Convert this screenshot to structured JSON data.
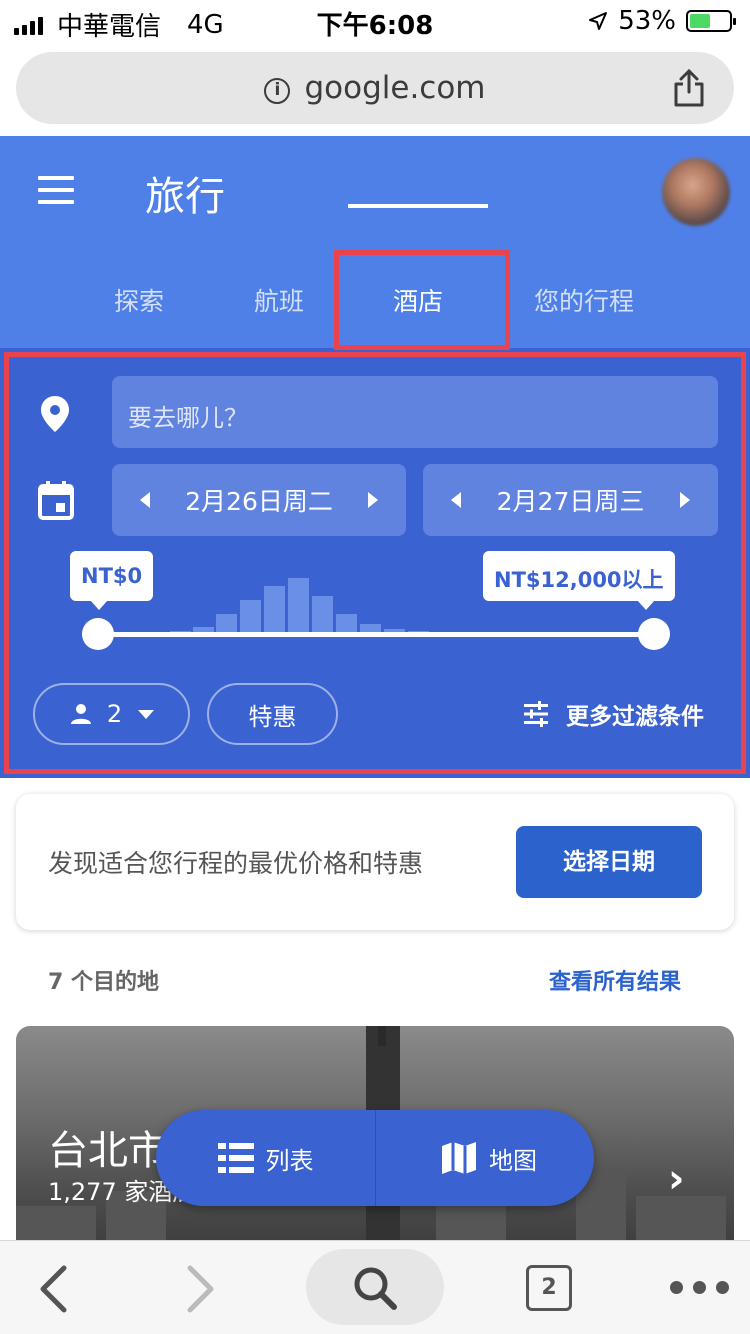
{
  "status_bar": {
    "carrier": "中華電信",
    "network": "4G",
    "time": "下午6:08",
    "battery": "53%",
    "battery_fraction": 0.53
  },
  "browser": {
    "url": "google.com"
  },
  "app": {
    "title": "旅行"
  },
  "tabs": [
    {
      "label": "探索",
      "active": false
    },
    {
      "label": "航班",
      "active": false
    },
    {
      "label": "酒店",
      "active": true
    },
    {
      "label": "您的行程",
      "active": false
    }
  ],
  "search": {
    "destination_placeholder": "要去哪儿？",
    "check_in": "2月26日周二",
    "check_out": "2月27日周三",
    "price_min": "NT$0",
    "price_max": "NT$12,000以上",
    "guests": "2",
    "deals_label": "特惠",
    "more_filters": "更多过滤条件"
  },
  "promo": {
    "text": "发现适合您行程的最优价格和特惠",
    "button": "选择日期"
  },
  "results": {
    "count_label": "7 个目的地",
    "view_all": "查看所有结果"
  },
  "destination_card": {
    "city": "台北市",
    "hotels": "1,277 家酒店"
  },
  "view_toggle": {
    "list": "列表",
    "map": "地图"
  },
  "bottom_bar": {
    "tab_count": "2"
  },
  "colors": {
    "header": "#4f80e8",
    "panel": "#3a62d0",
    "accent": "#2b62cc",
    "highlight": "#e8434f"
  }
}
